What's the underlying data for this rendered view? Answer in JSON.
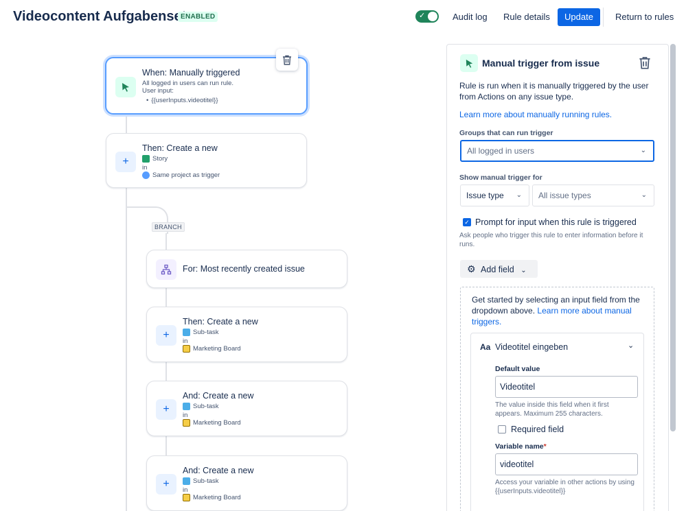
{
  "header": {
    "title": "Videocontent Aufgabenset",
    "status_badge": "ENABLED",
    "audit_log": "Audit log",
    "rule_details": "Rule details",
    "update": "Update",
    "return": "Return to rules"
  },
  "canvas": {
    "trigger": {
      "title": "When: Manually triggered",
      "line1": "All logged in users can run rule.",
      "line2": "User input:",
      "line3": "{{userInputs.videotitel}}"
    },
    "action1": {
      "title": "Then: Create a new",
      "type": "Story",
      "in": "in",
      "project": "Same project as trigger"
    },
    "branch_tag": "BRANCH",
    "branch": {
      "title": "For: Most recently created issue"
    },
    "sub1": {
      "title": "Then: Create a new",
      "type": "Sub-task",
      "in": "in",
      "project": "Marketing Board"
    },
    "sub2": {
      "title": "And: Create a new",
      "type": "Sub-task",
      "in": "in",
      "project": "Marketing Board"
    },
    "sub3": {
      "title": "And: Create a new",
      "type": "Sub-task",
      "in": "in",
      "project": "Marketing Board"
    }
  },
  "panel": {
    "title": "Manual trigger from issue",
    "desc": "Rule is run when it is manually triggered by the user from Actions on any issue type.",
    "learn_more": "Learn more about manually running rules.",
    "groups_label": "Groups that can run trigger",
    "groups_value": "All logged in users",
    "show_label": "Show manual trigger for",
    "show_type": "Issue type",
    "show_value": "All issue types",
    "prompt_label": "Prompt for input when this rule is triggered",
    "prompt_help": "Ask people who trigger this rule to enter information before it runs.",
    "add_field": "Add field",
    "get_started": "Get started by selecting an input field from the dropdown above.",
    "learn_triggers": "Learn more about manual triggers.",
    "field": {
      "title": "Videotitel eingeben",
      "default_label": "Default value",
      "default_value": "Videotitel",
      "default_help": "The value inside this field when it first appears. Maximum 255 characters.",
      "required_label": "Required field",
      "var_label": "Variable name",
      "var_value": "videotitel",
      "var_help": "Access your variable in other actions by using {{userInputs.videotitel}}"
    }
  }
}
